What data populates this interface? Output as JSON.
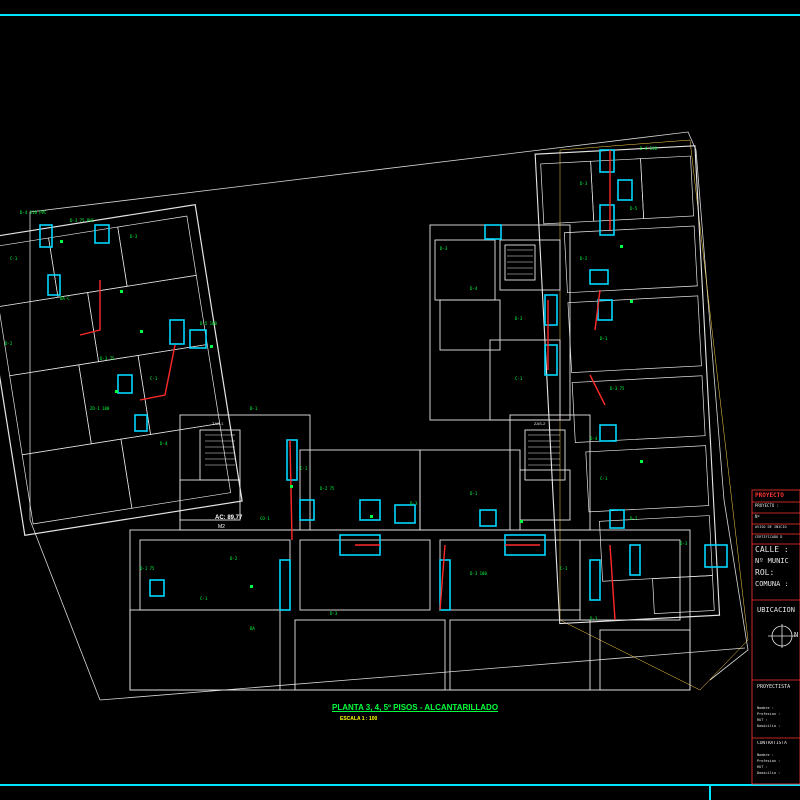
{
  "drawing": {
    "title": "PLANTA 3, 4, 5º PISOS - ALCANTARILLADO",
    "scale": "ESCALA 1 : 100",
    "colors": {
      "background": "#000000",
      "frame": "#00e5ff",
      "walls": "#e6e6e6",
      "plumbing": "#00d8ff",
      "labels": "#00ff3c",
      "pipes": "#ff2a2a",
      "title": "#ffff00",
      "panel": "#ff3333",
      "boundary": "#ffd24d"
    }
  },
  "stair_labels": [
    "ZAS-1",
    "ZAS-2"
  ],
  "area_label": {
    "line1": "AC: 89,77",
    "line2": "M2"
  },
  "title_block": {
    "header": "PROYECTO",
    "rows": [
      "PROYECTO :",
      "Nº",
      "AVISO DE INICIO",
      "CERTIFICADO D"
    ],
    "address": [
      "CALLE :",
      "Nº MUNIC",
      "ROL:",
      "COMUNA :"
    ],
    "location": "UBICACION",
    "north": "N",
    "owner_title": "PROYECTISTA",
    "owner_fields": [
      "Nombre :",
      "Profesion :",
      "RUT :",
      "Domicilio :"
    ],
    "contractor_title": "CONTRATISTA",
    "contractor_fields": [
      "Nombre :",
      "Profesion :",
      "RUT :",
      "Domicilio :"
    ]
  }
}
